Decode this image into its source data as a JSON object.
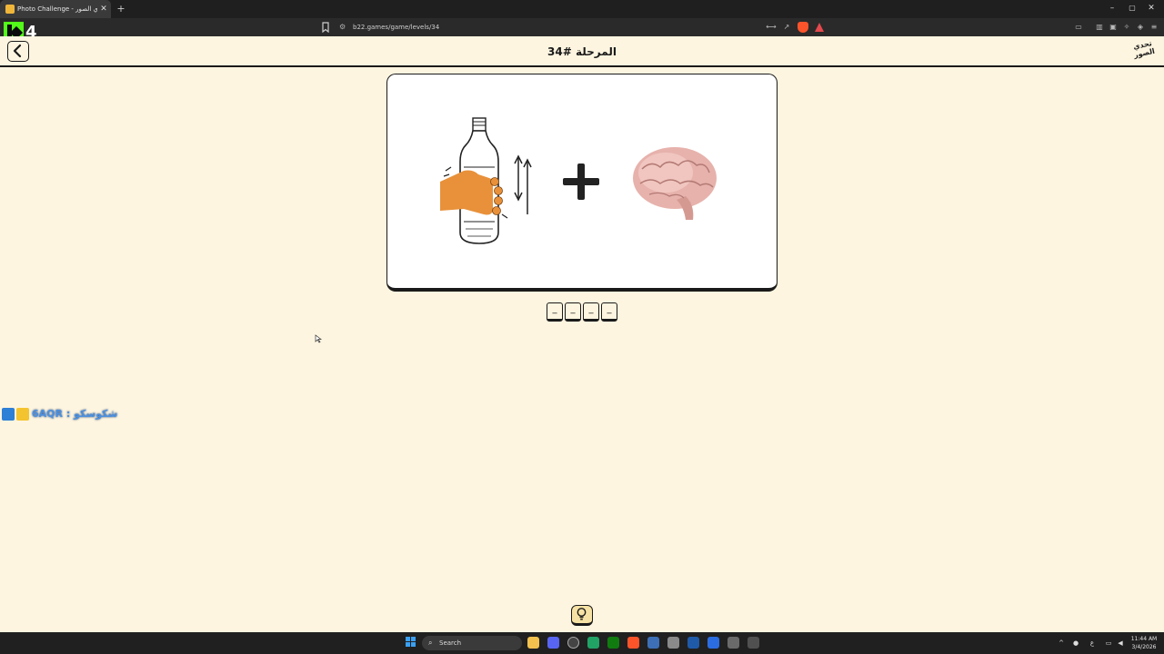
{
  "browser": {
    "tab_title": "Photo Challenge - تحدي الصور",
    "tab_close": "✕",
    "new_tab": "+",
    "url": "b22.games/game/levels/34",
    "window_minimize": "–",
    "window_maximize": "▢",
    "window_close": "✕"
  },
  "stream_overlay": {
    "badge_number": "4",
    "credit_text": "6AQR : شكوسكو"
  },
  "page": {
    "title": "المرحلة #34",
    "logo_text": "تحدي الصور"
  },
  "puzzle": {
    "clues": [
      "hand-squeezing-bottle",
      "plus",
      "brain"
    ],
    "answer_slots": [
      "_",
      "_",
      "_",
      "_"
    ]
  },
  "taskbar": {
    "search_label": "Search",
    "clock_time": "11:44 AM",
    "clock_date": "3/4/2026",
    "language": "ع"
  },
  "colors": {
    "page_background": "#fdf5e0",
    "hand": "#e8913a",
    "accent_border": "#1a1a1a",
    "hint_button": "#f6e2a4"
  },
  "icons": [
    "back-arrow-icon",
    "lightbulb-icon",
    "plus-icon",
    "bookmark-icon",
    "brave-shield-icon"
  ]
}
